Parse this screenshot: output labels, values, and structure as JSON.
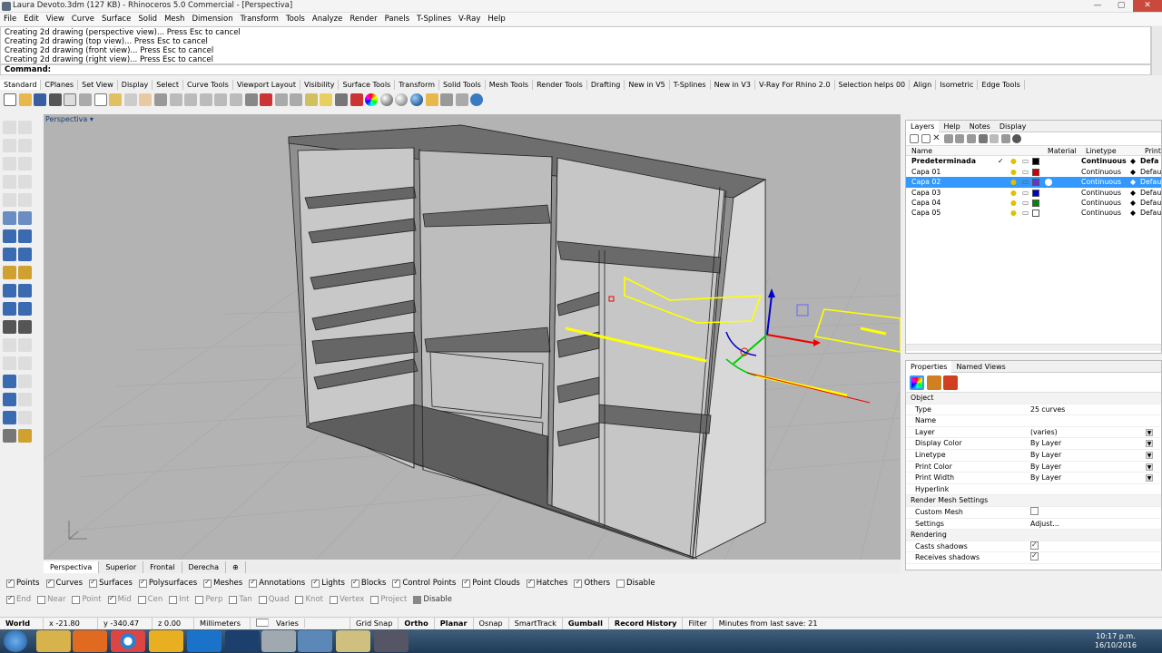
{
  "window": {
    "title": "Laura Devoto.3dm (127 KB) - Rhinoceros 5.0 Commercial - [Perspectiva]"
  },
  "menu": [
    "File",
    "Edit",
    "View",
    "Curve",
    "Surface",
    "Solid",
    "Mesh",
    "Dimension",
    "Transform",
    "Tools",
    "Analyze",
    "Render",
    "Panels",
    "T-Splines",
    "V-Ray",
    "Help"
  ],
  "command": {
    "history": [
      "Creating 2d drawing (perspective view)... Press Esc to cancel",
      "Creating 2d drawing (top view)... Press Esc to cancel",
      "Creating 2d drawing (front view)... Press Esc to cancel",
      "Creating 2d drawing (right view)... Press Esc to cancel"
    ],
    "prompt": "Command:"
  },
  "toolbar_tabs": [
    "Standard",
    "CPlanes",
    "Set View",
    "Display",
    "Select",
    "Curve Tools",
    "Viewport Layout",
    "Visibility",
    "Surface Tools",
    "Transform",
    "Solid Tools",
    "Mesh Tools",
    "Render Tools",
    "Drafting",
    "New in V5",
    "T-Splines",
    "New in V3",
    "V-Ray For Rhino 2.0",
    "Selection helps 00",
    "Align",
    "Isometric",
    "Edge Tools"
  ],
  "viewport": {
    "label": "Perspectiva"
  },
  "viewport_tabs": [
    "Perspectiva",
    "Superior",
    "Frontal",
    "Derecha"
  ],
  "object_filters": [
    "Points",
    "Curves",
    "Surfaces",
    "Polysurfaces",
    "Meshes",
    "Annotations",
    "Lights",
    "Blocks",
    "Control Points",
    "Point Clouds",
    "Hatches",
    "Others"
  ],
  "osnaps": [
    "End",
    "Near",
    "Point",
    "Mid",
    "Cen",
    "Int",
    "Perp",
    "Tan",
    "Quad",
    "Knot",
    "Vertex",
    "Project"
  ],
  "disable_label": "Disable",
  "status": {
    "cplane": "World",
    "x": "x -21.80",
    "y": "y -340.47",
    "z": "z 0.00",
    "units": "Millimeters",
    "layer": "Varies",
    "toggles": [
      "Grid Snap",
      "Ortho",
      "Planar",
      "Osnap",
      "SmartTrack",
      "Gumball",
      "Record History",
      "Filter"
    ],
    "save": "Minutes from last save: 21"
  },
  "layers_panel": {
    "tabs": [
      "Layers",
      "Help",
      "Notes",
      "Display"
    ],
    "columns": [
      "Name",
      "Material",
      "Linetype",
      "Print W"
    ],
    "rows": [
      {
        "name": "Predeterminada",
        "linetype": "Continuous",
        "print": "Defa",
        "color": "#000000",
        "current": true
      },
      {
        "name": "Capa 01",
        "linetype": "Continuous",
        "print": "Default",
        "color": "#cc0000"
      },
      {
        "name": "Capa 02",
        "linetype": "Continuous",
        "print": "Default",
        "color": "#6633cc",
        "selected": true
      },
      {
        "name": "Capa 03",
        "linetype": "Continuous",
        "print": "Default",
        "color": "#0000cc"
      },
      {
        "name": "Capa 04",
        "linetype": "Continuous",
        "print": "Default",
        "color": "#008800"
      },
      {
        "name": "Capa 05",
        "linetype": "Continuous",
        "print": "Default",
        "color": "#ffffff"
      }
    ],
    "current_mark": "✓"
  },
  "properties_panel": {
    "tabs": [
      "Properties",
      "Named Views"
    ],
    "rows": [
      {
        "section": "Object"
      },
      {
        "key": "Type",
        "value": "25 curves"
      },
      {
        "key": "Name",
        "value": ""
      },
      {
        "key": "Layer",
        "value": "(varies)",
        "dropdown": true
      },
      {
        "key": "Display Color",
        "value": "By Layer",
        "dropdown": true
      },
      {
        "key": "Linetype",
        "value": "By Layer",
        "dropdown": true
      },
      {
        "key": "Print Color",
        "value": "By Layer",
        "dropdown": true
      },
      {
        "key": "Print Width",
        "value": "By Layer",
        "dropdown": true
      },
      {
        "key": "Hyperlink",
        "value": ""
      },
      {
        "section": "Render Mesh Settings"
      },
      {
        "key": "Custom Mesh",
        "value": "",
        "check": false
      },
      {
        "key": "Settings",
        "value": "Adjust..."
      },
      {
        "section": "Rendering"
      },
      {
        "key": "Casts shadows",
        "value": "",
        "check": true
      },
      {
        "key": "Receives shadows",
        "value": "",
        "check": true
      }
    ]
  },
  "clock": {
    "time": "10:17 p.m.",
    "date": "16/10/2016"
  },
  "colors": {
    "selection": "#3399ff",
    "viewport_bg": "#b3b3b3",
    "highlight_curve": "#ffff00"
  }
}
